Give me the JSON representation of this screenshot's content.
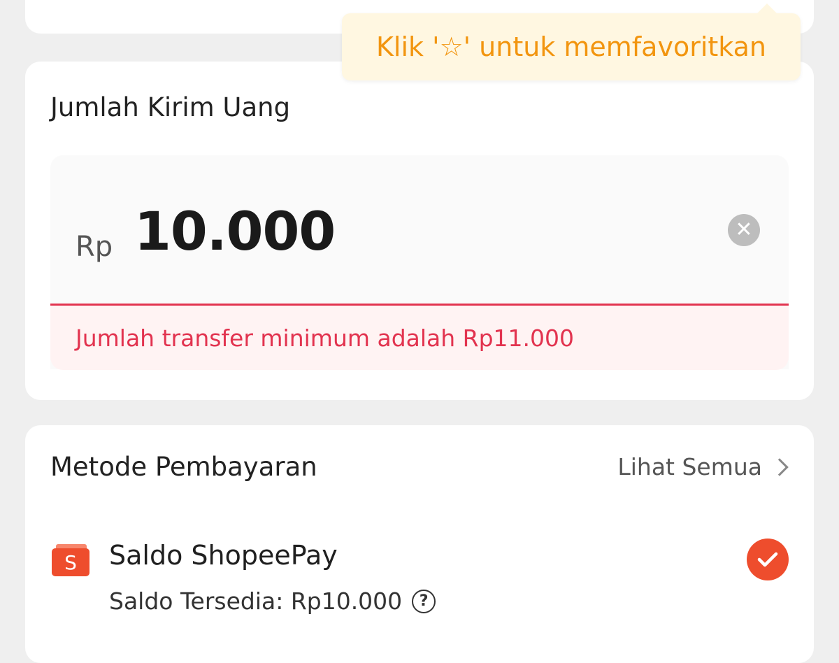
{
  "tooltip": {
    "text": "Klik '☆' untuk memfavoritkan"
  },
  "amount_section": {
    "title": "Jumlah Kirim Uang",
    "currency": "Rp",
    "amount": "10.000",
    "error": "Jumlah transfer minimum adalah Rp11.000"
  },
  "payment_section": {
    "title": "Metode Pembayaran",
    "see_all": "Lihat Semua",
    "method": {
      "name": "Saldo ShopeePay",
      "balance": "Saldo Tersedia: Rp10.000",
      "icon": "shopeepay-wallet-icon",
      "selected": true
    }
  },
  "colors": {
    "accent": "#ee4d2d",
    "error": "#e2334f",
    "tooltip_text": "#f2950f",
    "tooltip_bg": "#fff7e1"
  }
}
